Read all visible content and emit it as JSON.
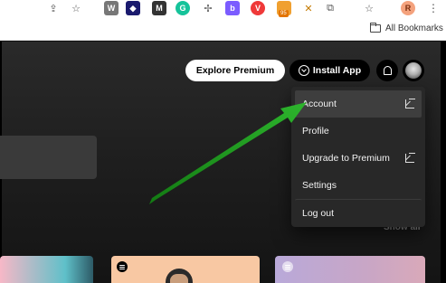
{
  "browser": {
    "toolbar_icons": [
      "save-page-icon",
      "star-icon",
      "wordpress-icon",
      "extension-flame-icon",
      "mail-icon",
      "grammarly-icon",
      "extension-plus-icon",
      "extension-b-icon",
      "vivaldi-icon",
      "extension-badge-icon",
      "tools-icon",
      "extensions-puzzle-icon",
      "pin-icon",
      "profile-avatar",
      "kebab-menu-icon"
    ],
    "extension_badge_text": "95",
    "profile_initial": "R",
    "bookmarks_label": "All Bookmarks"
  },
  "header": {
    "explore_premium_label": "Explore Premium",
    "install_app_label": "Install App"
  },
  "menu": {
    "items": [
      {
        "label": "Account",
        "external": true
      },
      {
        "label": "Profile",
        "external": false
      },
      {
        "label": "Upgrade to Premium",
        "external": true
      },
      {
        "label": "Settings",
        "external": false
      },
      {
        "label": "Log out",
        "external": false
      }
    ]
  },
  "content": {
    "show_all_label": "Show all"
  },
  "colors": {
    "spotify_bg": "#121212",
    "menu_bg": "#282828",
    "menu_active": "#3e3e3e",
    "annotation_arrow": "#1f8f1f"
  }
}
